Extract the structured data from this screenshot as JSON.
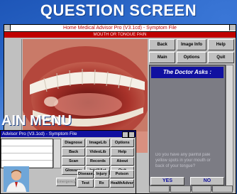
{
  "headline": "QUESTION SCREEN",
  "question_window": {
    "title": "Home Medical Advisor Pro (V3.1cd) - Symptom File",
    "subtitle": "MOUTH OR TONGUE PAIN",
    "buttons": [
      "Back",
      "Image Info",
      "Help",
      "Main",
      "Options",
      "Quit"
    ],
    "doctor_heading": "The Doctor Asks :",
    "doctor_text": "Do you have any painful pale yellow spots in your mouth or back of your tongue?",
    "yes_label": "YES",
    "no_label": "NO"
  },
  "menu_heading": "AIN MENU",
  "main_menu_window": {
    "title": "Advisor Pro (V3.1cd) - Symptom File",
    "buttons_top": [
      "Diagnose",
      "ImageLib",
      "Options",
      "Back",
      "VideoLib",
      "Help",
      "Scan",
      "Records",
      "About",
      "Glossary",
      "IntelliAct",
      "Quit"
    ],
    "emergency_label": "Emergency",
    "buttons_bottom": [
      "Disease",
      "Injury",
      "Poison",
      "Test",
      "Rx",
      "HealthAdvsr"
    ]
  },
  "colors": {
    "background": "#2a5fb3",
    "title_red": "#c00000",
    "doctor_panel": "#7c7c84",
    "doctor_header": "#1010a0"
  }
}
